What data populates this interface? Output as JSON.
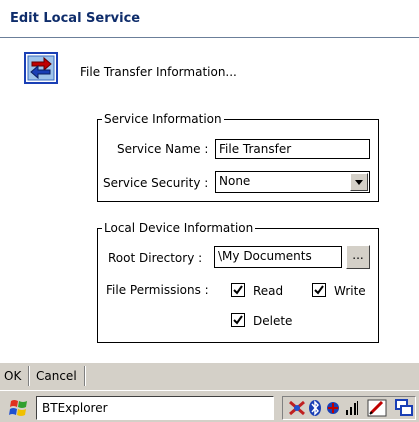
{
  "window": {
    "title": "Edit Local Service"
  },
  "header": {
    "text": "File Transfer Information...",
    "icon": "file-transfer-icon"
  },
  "service_info": {
    "legend": "Service Information",
    "name_label": "Service Name :",
    "name_value": "File Transfer",
    "security_label": "Service Security :",
    "security_value": "None"
  },
  "local_device": {
    "legend": "Local Device Information",
    "root_label": "Root Directory :",
    "root_value": "\\My Documents",
    "browse_label": "...",
    "permissions_label": "File Permissions :",
    "read_label": "Read",
    "write_label": "Write",
    "delete_label": "Delete",
    "read_checked": true,
    "write_checked": true,
    "delete_checked": true
  },
  "menu": {
    "ok": "OK",
    "cancel": "Cancel"
  },
  "taskbar": {
    "app_name": "BTExplorer"
  },
  "colors": {
    "title": "#0f2d6b",
    "chrome": "#d4d0c8",
    "accent_red": "#c00000",
    "accent_blue": "#1a3fb5"
  }
}
